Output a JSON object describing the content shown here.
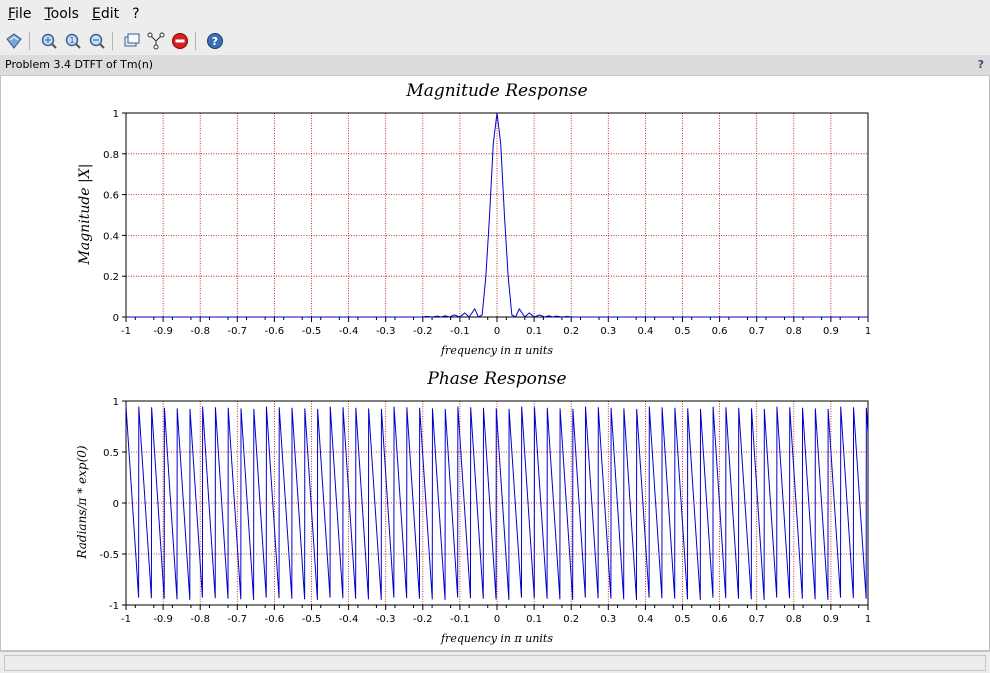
{
  "menu": {
    "file": "File",
    "tools": "Tools",
    "edit": "Edit",
    "help": "?"
  },
  "toolbar": {
    "icons": [
      "datatip-icon",
      "zoom-icon",
      "zoom-region-icon",
      "unzoom-icon",
      "rotate-icon",
      "graph-icon",
      "stop-icon",
      "help-icon"
    ]
  },
  "infobar": {
    "title": "Problem 3.4 DTFT of Tm(n)",
    "help": "?"
  },
  "colors": {
    "curve": "#0000cc",
    "grid": "#b30000",
    "axis": "#000000"
  },
  "chart_data": [
    {
      "type": "line",
      "title": "Magnitude Response",
      "xlabel": "frequency in π units",
      "ylabel": "Magnitude |X|",
      "xlim": [
        -1,
        1
      ],
      "ylim": [
        0,
        1
      ],
      "x_ticks": [
        "-1",
        "-0.9",
        "-0.8",
        "-0.7",
        "-0.6",
        "-0.5",
        "-0.4",
        "-0.3",
        "-0.2",
        "-0.1",
        "0",
        "0.1",
        "0.2",
        "0.3",
        "0.4",
        "0.5",
        "0.6",
        "0.7",
        "0.8",
        "0.9",
        "1"
      ],
      "y_ticks": [
        "0",
        "0.2",
        "0.4",
        "0.6",
        "0.8",
        "1"
      ],
      "grid": true,
      "series": [
        {
          "x": [
            -1,
            -0.2,
            -0.19,
            -0.175,
            -0.16,
            -0.15,
            -0.14,
            -0.128,
            -0.115,
            -0.1,
            -0.087,
            -0.075,
            -0.06,
            -0.05,
            -0.04,
            -0.03,
            -0.02,
            -0.01,
            0,
            0.01,
            0.02,
            0.03,
            0.04,
            0.05,
            0.06,
            0.075,
            0.087,
            0.1,
            0.115,
            0.128,
            0.14,
            0.15,
            0.16,
            0.175,
            0.19,
            0.2,
            1
          ],
          "y": [
            0,
            0,
            0.003,
            0,
            0.004,
            0,
            0.006,
            0,
            0.01,
            0,
            0.02,
            0,
            0.04,
            0,
            0.01,
            0.2,
            0.5,
            0.85,
            1,
            0.85,
            0.5,
            0.2,
            0.01,
            0,
            0.04,
            0,
            0.02,
            0,
            0.01,
            0,
            0.006,
            0,
            0.004,
            0,
            0.003,
            0,
            0
          ]
        }
      ]
    },
    {
      "type": "line",
      "title": "Phase Response",
      "xlabel": "frequency in π units",
      "ylabel": "Radians/π * exp(0)",
      "xlim": [
        -1,
        1
      ],
      "ylim": [
        -1,
        1
      ],
      "x_ticks": [
        "-1",
        "-0.9",
        "-0.8",
        "-0.7",
        "-0.6",
        "-0.5",
        "-0.4",
        "-0.3",
        "-0.2",
        "-0.1",
        "0",
        "0.1",
        "0.2",
        "0.3",
        "0.4",
        "0.5",
        "0.6",
        "0.7",
        "0.8",
        "0.9",
        "1"
      ],
      "y_ticks": [
        "-1",
        "-0.5",
        "0",
        "0.5",
        "1"
      ],
      "grid": true,
      "sawtooth_period": 0.0344,
      "notes": "sawtooth phase wrapping between -1 and 1"
    }
  ]
}
